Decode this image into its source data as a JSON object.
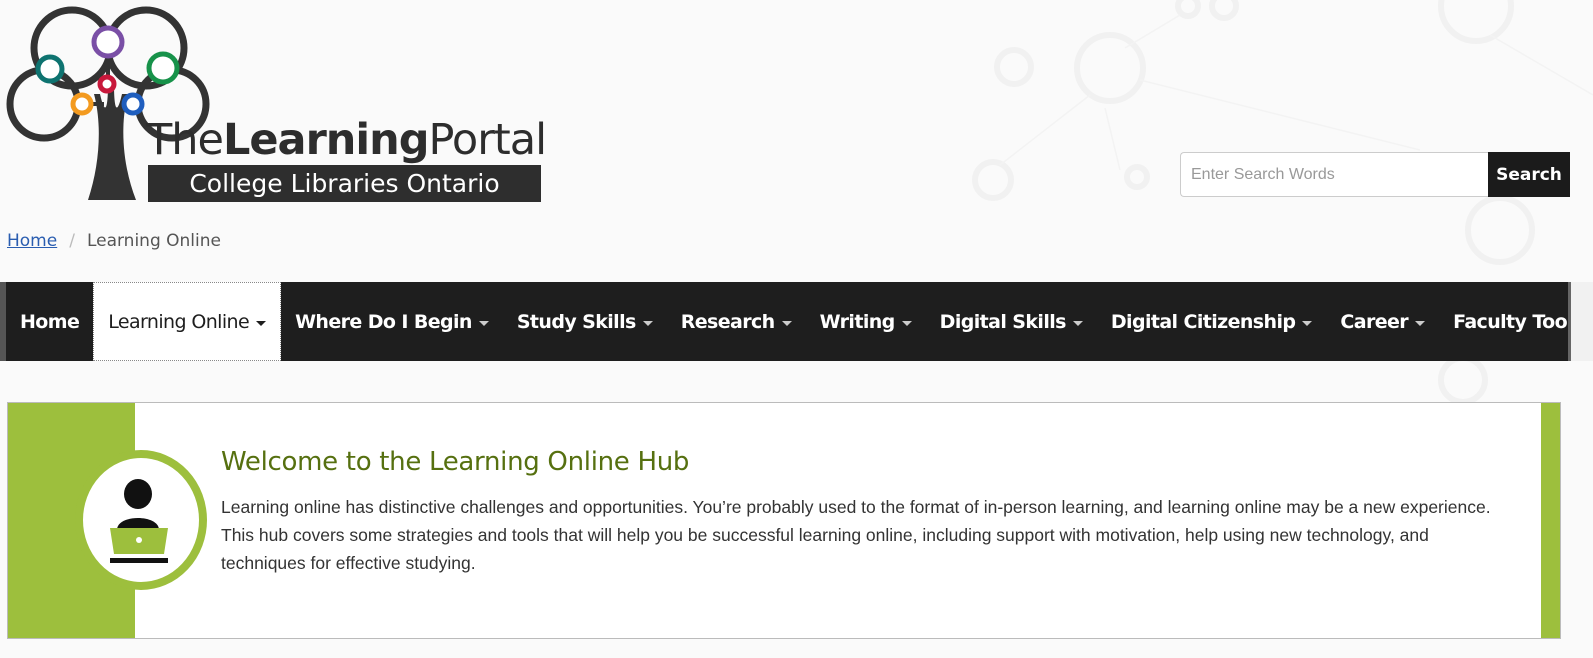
{
  "brand": {
    "title_light_1": "The",
    "title_bold": "Learning",
    "title_light_2": "Portal",
    "subtitle": "College Libraries Ontario",
    "tree_circle_colors": [
      "#7a4fa6",
      "#0e7370",
      "#17924a",
      "#c8183b",
      "#f39a1f",
      "#1f5ebe"
    ]
  },
  "search": {
    "placeholder": "Enter Search Words",
    "value": "",
    "button_label": "Search"
  },
  "breadcrumb": {
    "home_label": "Home",
    "separator": "/",
    "current": "Learning Online"
  },
  "nav": {
    "items": [
      {
        "label": "Home",
        "dropdown": false,
        "active": false
      },
      {
        "label": "Learning Online",
        "dropdown": true,
        "active": true
      },
      {
        "label": "Where Do I Begin",
        "dropdown": true,
        "active": false
      },
      {
        "label": "Study Skills",
        "dropdown": true,
        "active": false
      },
      {
        "label": "Research",
        "dropdown": true,
        "active": false
      },
      {
        "label": "Writing",
        "dropdown": true,
        "active": false
      },
      {
        "label": "Digital Skills",
        "dropdown": true,
        "active": false
      },
      {
        "label": "Digital Citizenship",
        "dropdown": true,
        "active": false
      },
      {
        "label": "Career",
        "dropdown": true,
        "active": false
      },
      {
        "label": "Faculty Toolkit",
        "dropdown": true,
        "active": false
      }
    ]
  },
  "hub": {
    "title": "Welcome to the Learning Online Hub",
    "body": "Learning online has distinctive challenges and opportunities. You’re probably used to the format of in-person learning, and learning online may be a new experience. This hub covers some strategies and tools that will help you be successful learning online, including support with motivation, help using new technology, and techniques for effective studying.",
    "icon": "person-at-laptop-icon",
    "accent_color": "#9dbf3d",
    "title_color": "#567010"
  },
  "colors": {
    "navbar_bg": "#1e1e1e",
    "link": "#2a5db0",
    "search_button_bg": "#1b1b1b"
  }
}
